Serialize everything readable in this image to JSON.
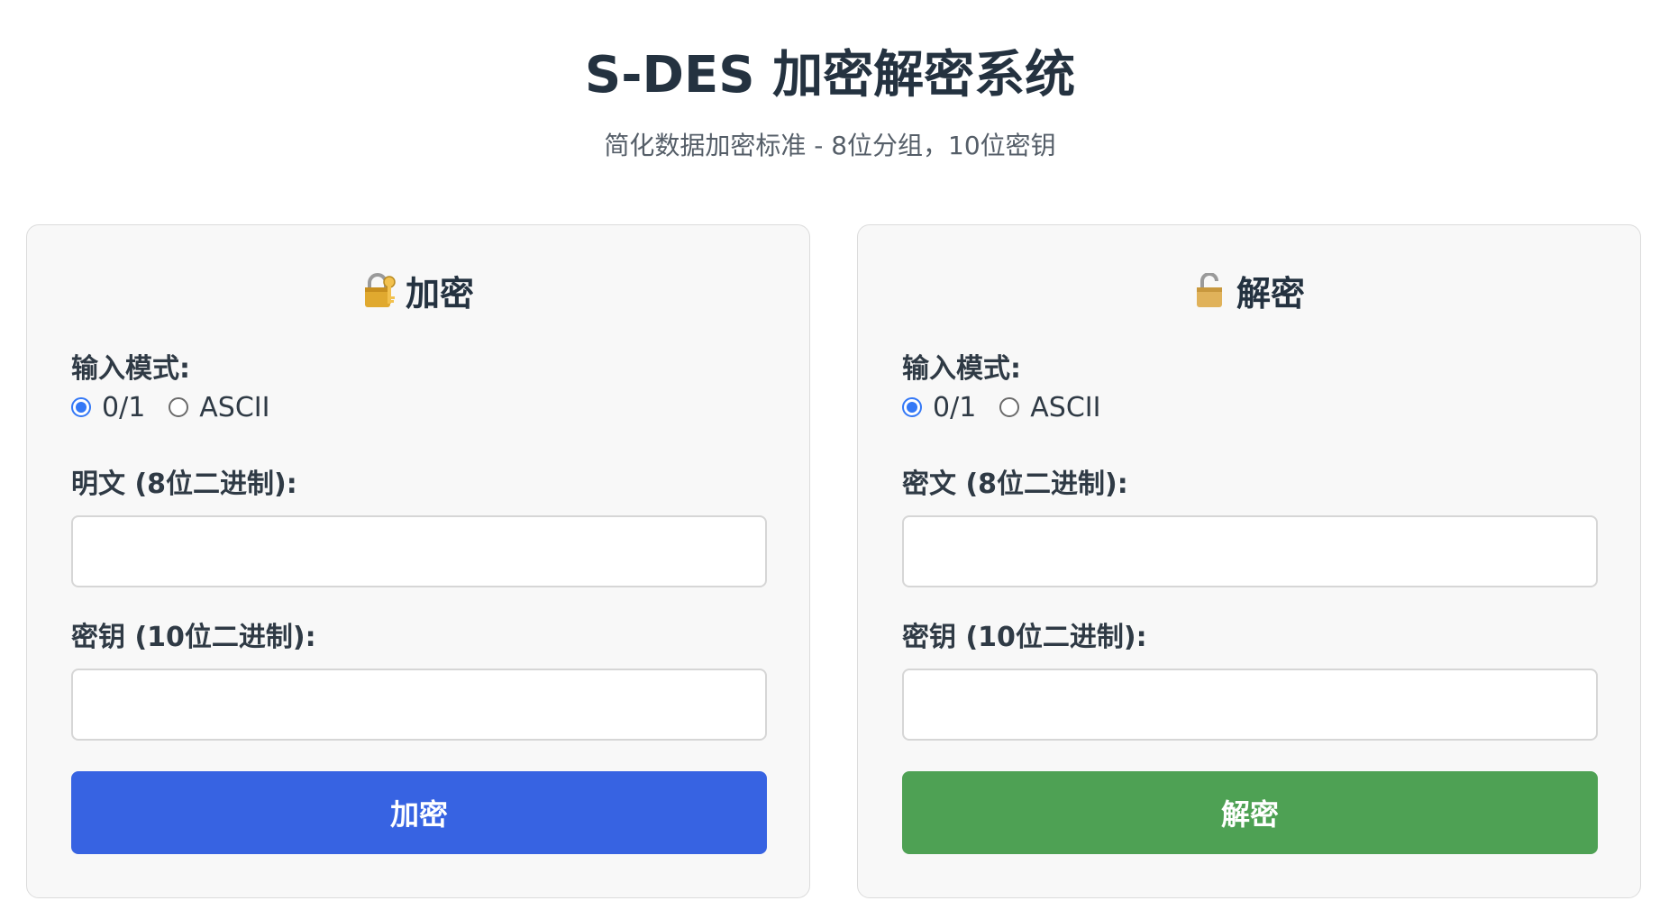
{
  "header": {
    "title": "S-DES 加密解密系统",
    "subtitle": "简化数据加密标准 - 8位分组，10位密钥"
  },
  "encrypt_panel": {
    "title": "加密",
    "icon": "lock-with-key-icon",
    "mode_label": "输入模式:",
    "mode_options": [
      "0/1",
      "ASCII"
    ],
    "mode_selected": "0/1",
    "text_label": "明文 (8位二进制):",
    "text_value": "",
    "key_label": "密钥 (10位二进制):",
    "key_value": "",
    "button_label": "加密",
    "button_color": "#3763e2"
  },
  "decrypt_panel": {
    "title": "解密",
    "icon": "open-lock-icon",
    "mode_label": "输入模式:",
    "mode_options": [
      "0/1",
      "ASCII"
    ],
    "mode_selected": "0/1",
    "text_label": "密文 (8位二进制):",
    "text_value": "",
    "key_label": "密钥 (10位二进制):",
    "key_value": "",
    "button_label": "解密",
    "button_color": "#4ea154"
  },
  "colors": {
    "radio_accent": "#3478f6",
    "panel_background": "#f8f8f8"
  }
}
